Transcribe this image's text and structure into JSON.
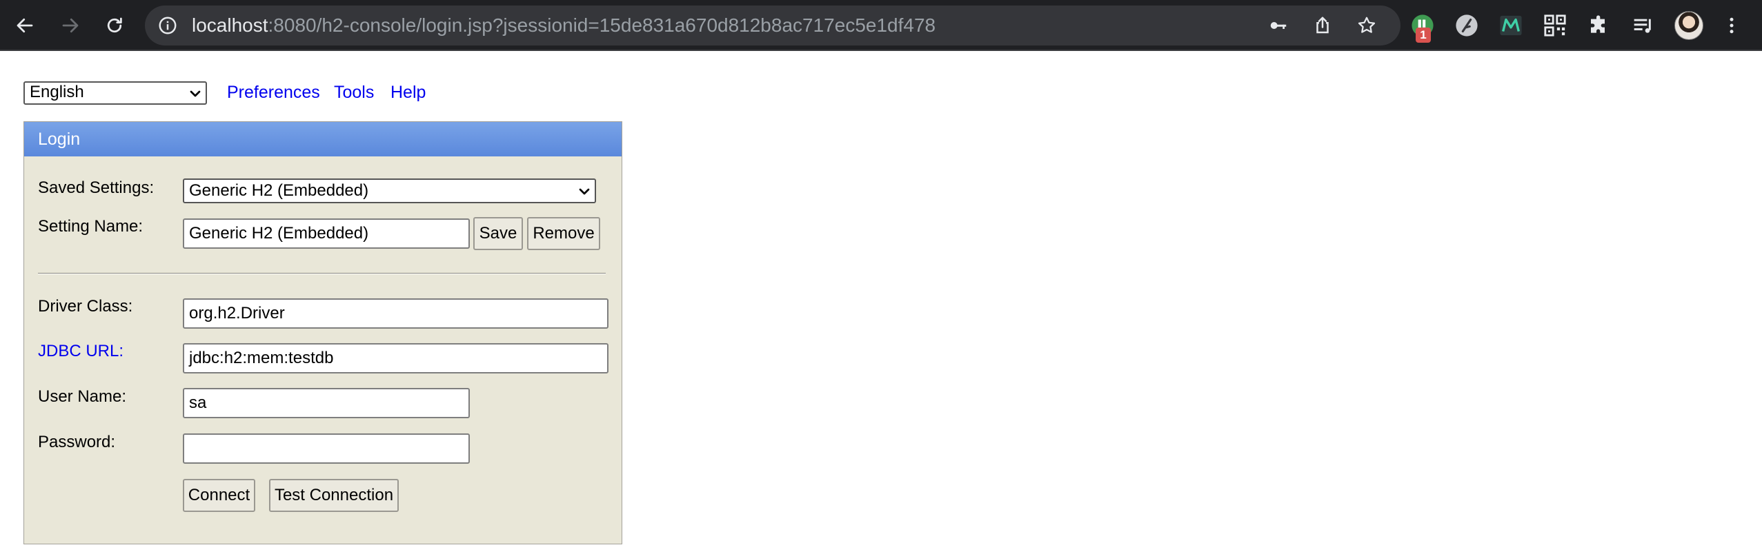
{
  "browser": {
    "url_host": "localhost",
    "url_rest": ":8080/h2-console/login.jsp?jsessionid=15de831a670d812b8ac717ec5e1df478",
    "extension_badge": "1",
    "icons": [
      "back-icon",
      "forward-icon",
      "reload-icon",
      "site-info-icon",
      "password-key-icon",
      "share-icon",
      "bookmark-star-icon",
      "extension-ublock-icon",
      "extension-feather-icon",
      "extension-m-icon",
      "qr-code-icon",
      "extensions-puzzle-icon",
      "reading-list-icon",
      "profile-avatar",
      "menu-kebab-icon"
    ]
  },
  "topbar": {
    "language": "English",
    "links": [
      "Preferences",
      "Tools",
      "Help"
    ]
  },
  "login": {
    "header": "Login",
    "saved_settings_label": "Saved Settings:",
    "saved_settings_value": "Generic H2 (Embedded)",
    "setting_name_label": "Setting Name:",
    "setting_name_value": "Generic H2 (Embedded)",
    "save_label": "Save",
    "remove_label": "Remove",
    "driver_class_label": "Driver Class:",
    "driver_class_value": "org.h2.Driver",
    "jdbc_url_label": "JDBC URL",
    "jdbc_url_colon": ":",
    "jdbc_url_value": "jdbc:h2:mem:testdb",
    "user_name_label": "User Name:",
    "user_name_value": "sa",
    "password_label": "Password:",
    "password_value": "",
    "connect_label": "Connect",
    "test_connection_label": "Test Connection"
  },
  "colors": {
    "panel_background": "#e9e7d8",
    "header_blue": "#6895e0",
    "link_blue": "#0000ee",
    "chrome_dark": "#1f2023"
  }
}
